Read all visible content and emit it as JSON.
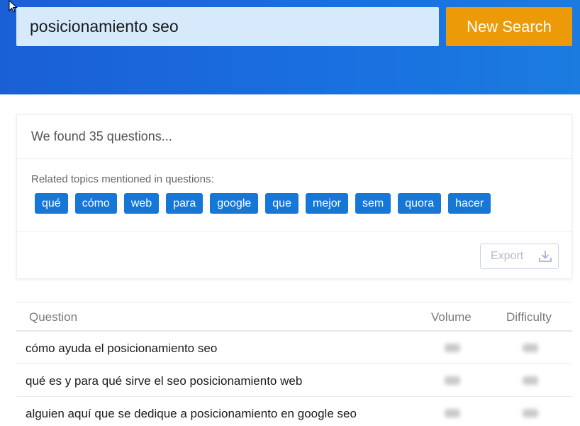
{
  "search": {
    "value": "posicionamiento seo",
    "button_label": "New Search"
  },
  "results": {
    "found_text": "We found 35 questions...",
    "topics_label": "Related topics mentioned in questions:",
    "topics": [
      "qué",
      "cómo",
      "web",
      "para",
      "google",
      "que",
      "mejor",
      "sem",
      "quora",
      "hacer"
    ],
    "export_label": "Export"
  },
  "table": {
    "headers": {
      "question": "Question",
      "volume": "Volume",
      "difficulty": "Difficulty"
    },
    "rows": [
      {
        "question": "cómo ayuda el posicionamiento seo"
      },
      {
        "question": "qué es y para qué sirve el seo posicionamiento web"
      },
      {
        "question": "alguien aquí que se dedique a posicionamiento en google seo"
      }
    ]
  },
  "colors": {
    "hero_blue": "#1a6fe0",
    "accent_orange": "#ec9a07",
    "chip_blue": "#1677d6"
  }
}
